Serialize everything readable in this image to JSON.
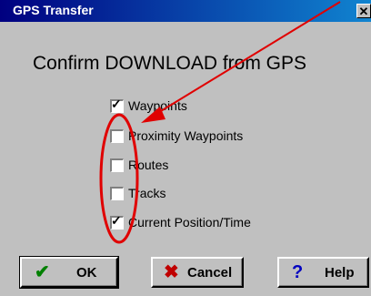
{
  "dialog": {
    "title": "GPS Transfer",
    "close_glyph": "✕",
    "heading": "Confirm DOWNLOAD from GPS"
  },
  "options": [
    {
      "label": "Waypoints",
      "checked": true
    },
    {
      "label": "Proximity Waypoints",
      "checked": false
    },
    {
      "label": "Routes",
      "checked": false
    },
    {
      "label": "Tracks",
      "checked": false
    },
    {
      "label": "Current Position/Time",
      "checked": true
    }
  ],
  "buttons": {
    "ok_label": "OK",
    "cancel_label": "Cancel",
    "help_label": "Help"
  },
  "icons": {
    "ok": "check-icon",
    "cancel": "x-icon",
    "help": "question-icon",
    "close": "close-icon"
  },
  "colors": {
    "title_bar": "#000080",
    "dialog_face": "#c0c0c0",
    "annotation": "#e00000",
    "ok_icon": "#008000",
    "cancel_icon": "#c00000",
    "help_icon": "#0000c0"
  }
}
